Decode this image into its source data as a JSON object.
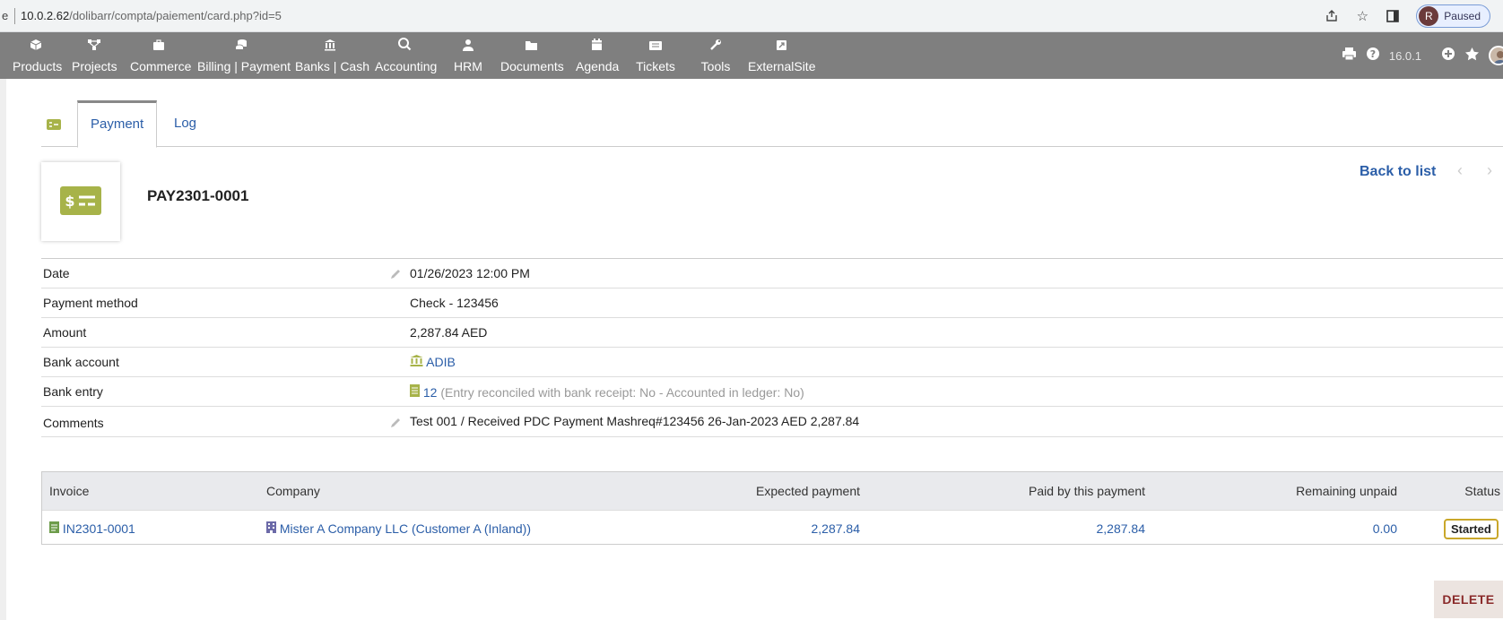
{
  "browser": {
    "tab_edge": "e",
    "url_host": "10.0.2.62",
    "url_path": "/dolibarr/compta/paiement/card.php?id=5",
    "profile_initial": "R",
    "profile_status": "Paused"
  },
  "menu": {
    "items": [
      {
        "label": "Products",
        "icon": "cube-icon"
      },
      {
        "label": "Projects",
        "icon": "sitemap-icon"
      },
      {
        "label": "Commerce",
        "icon": "briefcase-icon"
      },
      {
        "label": "Billing | Payment",
        "icon": "coins-icon"
      },
      {
        "label": "Banks | Cash",
        "icon": "bank-icon"
      },
      {
        "label": "Accounting",
        "icon": "search-dollar-icon"
      },
      {
        "label": "HRM",
        "icon": "user-tie-icon"
      },
      {
        "label": "Documents",
        "icon": "folder-open-icon"
      },
      {
        "label": "Agenda",
        "icon": "calendar-icon"
      },
      {
        "label": "Tickets",
        "icon": "ticket-icon"
      },
      {
        "label": "Tools",
        "icon": "wrench-icon"
      },
      {
        "label": "ExternalSite",
        "icon": "external-link-icon"
      }
    ],
    "version": "16.0.1"
  },
  "tabs": [
    {
      "label": "Payment",
      "active": true
    },
    {
      "label": "Log",
      "active": false
    }
  ],
  "header": {
    "ref": "PAY2301-0001",
    "back_to_list": "Back to list",
    "prev": "‹",
    "next": "›"
  },
  "fields": {
    "date_label": "Date",
    "date_value": "01/26/2023 12:00 PM",
    "method_label": "Payment method",
    "method_value": "Check - 123456",
    "amount_label": "Amount",
    "amount_value": "2,287.84 AED",
    "bank_account_label": "Bank account",
    "bank_account_value": "ADIB",
    "bank_entry_label": "Bank entry",
    "bank_entry_id": "12",
    "bank_entry_note": "(Entry reconciled with bank receipt: No - Accounted in ledger: No)",
    "comments_label": "Comments",
    "comments_value": "Test 001 / Received PDC Payment Mashreq#123456 26-Jan-2023 AED 2,287.84"
  },
  "invoice_table": {
    "headers": {
      "invoice": "Invoice",
      "company": "Company",
      "expected": "Expected payment",
      "paid": "Paid by this payment",
      "remaining": "Remaining unpaid",
      "status": "Status"
    },
    "rows": [
      {
        "invoice": "IN2301-0001",
        "company": "Mister A Company LLC (Customer A (Inland))",
        "expected": "2,287.84",
        "paid": "2,287.84",
        "remaining": "0.00",
        "status": "Started"
      }
    ]
  },
  "actions": {
    "delete": "DELETE"
  },
  "colors": {
    "menu_bg": "#7f7f7f",
    "link": "#2b5ea8",
    "payment_icon": "#a7b349",
    "status_border": "#c9a72a"
  }
}
